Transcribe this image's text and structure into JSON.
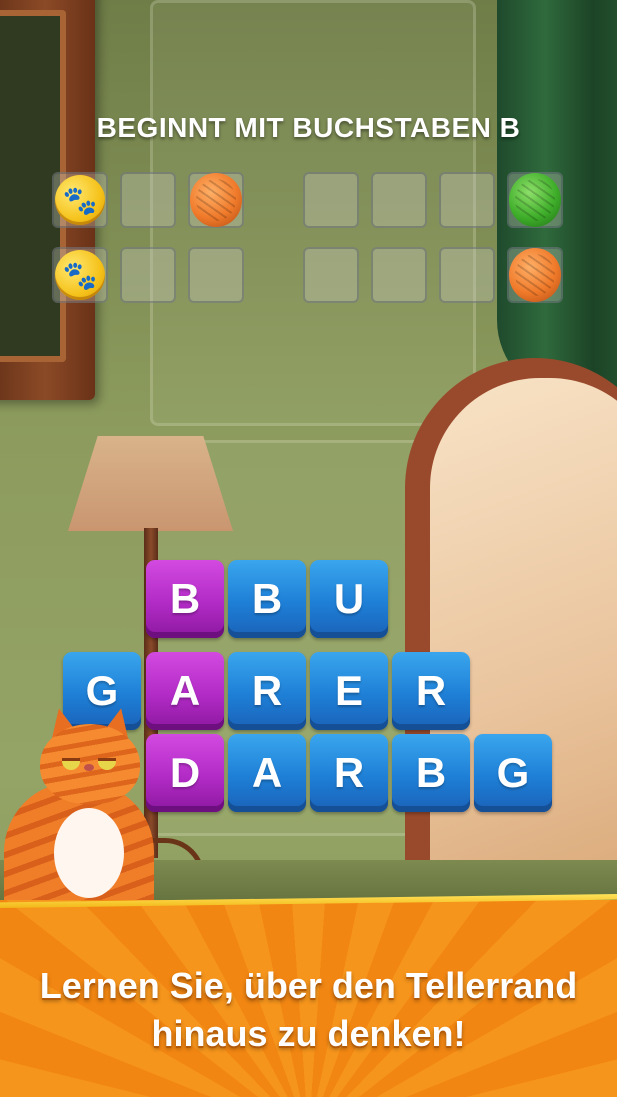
{
  "game": {
    "hint_title": "BEGINNT MIT BUCHSTABEN B",
    "answer_slots": [
      {
        "row": 1,
        "word": 1,
        "slots": [
          "coin-icon",
          "empty",
          "yarn-orange-icon"
        ]
      },
      {
        "row": 1,
        "word": 2,
        "slots": [
          "empty",
          "empty",
          "empty",
          "yarn-green-icon"
        ]
      },
      {
        "row": 2,
        "word": 1,
        "slots": [
          "coin-icon",
          "empty",
          "empty"
        ]
      },
      {
        "row": 2,
        "word": 2,
        "slots": [
          "empty",
          "empty",
          "empty",
          "yarn-orange-icon"
        ]
      }
    ],
    "tiles": {
      "row_top": [
        {
          "letter": "B",
          "color": "purple"
        },
        {
          "letter": "B",
          "color": "blue"
        },
        {
          "letter": "U",
          "color": "blue"
        }
      ],
      "row_middle": [
        {
          "letter": "G",
          "color": "blue"
        },
        {
          "letter": "A",
          "color": "purple"
        },
        {
          "letter": "R",
          "color": "blue"
        },
        {
          "letter": "E",
          "color": "blue"
        },
        {
          "letter": "R",
          "color": "blue"
        }
      ],
      "row_bottom": [
        {
          "letter": "D",
          "color": "purple"
        },
        {
          "letter": "A",
          "color": "blue"
        },
        {
          "letter": "R",
          "color": "blue"
        },
        {
          "letter": "B",
          "color": "blue"
        },
        {
          "letter": "G",
          "color": "blue"
        }
      ]
    },
    "colors": {
      "tile_blue": "#1e7fd6",
      "tile_purple": "#b22bc6",
      "banner": "#f28612",
      "coin": "#f5c21a"
    }
  },
  "banner": {
    "line1": "Lernen Sie, über den Tellerrand",
    "line2": "hinaus zu denken!"
  }
}
